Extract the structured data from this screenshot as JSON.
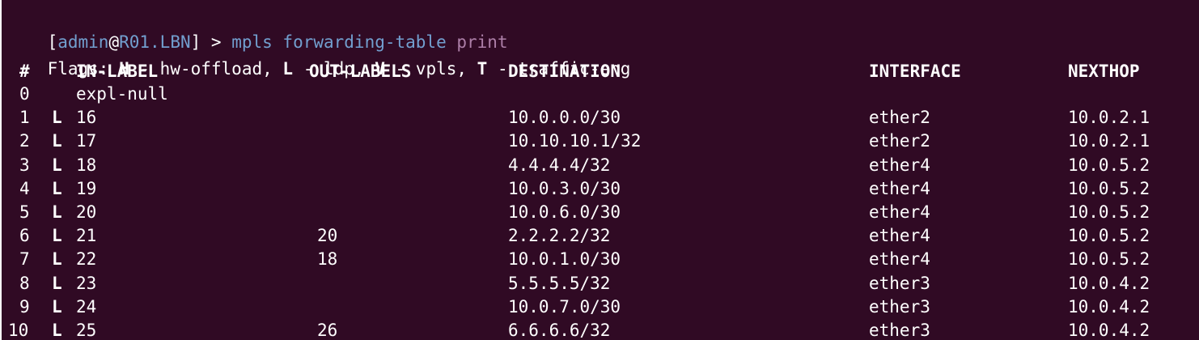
{
  "colors": {
    "background": "#300a24",
    "text": "#ffffff",
    "prompt_blue": "#729fcf",
    "print_purple": "#ad7fa8"
  },
  "prompt": {
    "open_bracket": "[",
    "user": "admin",
    "at": "@",
    "host": "R01.LBN",
    "close": "]",
    "symbol": " > ",
    "command": "mpls forwarding-table ",
    "print": "print"
  },
  "flags": {
    "prefix": "Flags: ",
    "h_key": "H",
    "h_desc": " - hw-offload, ",
    "l_key": "L",
    "l_desc": " - ldp, ",
    "v_key": "V",
    "v_desc": " - vpls, ",
    "t_key": "T",
    "t_desc": " - traffic-eng"
  },
  "headers": {
    "num": "#",
    "in_label": "IN-LABEL",
    "out_labels": "OUT-LABELS",
    "destination": "DESTINATION",
    "interface": "INTERFACE",
    "nexthop": "NEXTHOP"
  },
  "rows": [
    {
      "num": "0",
      "flag": "",
      "in": "expl-null",
      "out": "",
      "dest": "",
      "iface": "",
      "nh": ""
    },
    {
      "num": "1",
      "flag": "L",
      "in": "16",
      "out": "",
      "dest": "10.0.0.0/30",
      "iface": "ether2",
      "nh": "10.0.2.1"
    },
    {
      "num": "2",
      "flag": "L",
      "in": "17",
      "out": "",
      "dest": "10.10.10.1/32",
      "iface": "ether2",
      "nh": "10.0.2.1"
    },
    {
      "num": "3",
      "flag": "L",
      "in": "18",
      "out": "",
      "dest": "4.4.4.4/32",
      "iface": "ether4",
      "nh": "10.0.5.2"
    },
    {
      "num": "4",
      "flag": "L",
      "in": "19",
      "out": "",
      "dest": "10.0.3.0/30",
      "iface": "ether4",
      "nh": "10.0.5.2"
    },
    {
      "num": "5",
      "flag": "L",
      "in": "20",
      "out": "",
      "dest": "10.0.6.0/30",
      "iface": "ether4",
      "nh": "10.0.5.2"
    },
    {
      "num": "6",
      "flag": "L",
      "in": "21",
      "out": "20",
      "dest": "2.2.2.2/32",
      "iface": "ether4",
      "nh": "10.0.5.2"
    },
    {
      "num": "7",
      "flag": "L",
      "in": "22",
      "out": "18",
      "dest": "10.0.1.0/30",
      "iface": "ether4",
      "nh": "10.0.5.2"
    },
    {
      "num": "8",
      "flag": "L",
      "in": "23",
      "out": "",
      "dest": "5.5.5.5/32",
      "iface": "ether3",
      "nh": "10.0.4.2"
    },
    {
      "num": "9",
      "flag": "L",
      "in": "24",
      "out": "",
      "dest": "10.0.7.0/30",
      "iface": "ether3",
      "nh": "10.0.4.2"
    },
    {
      "num": "10",
      "flag": "L",
      "in": "25",
      "out": "26",
      "dest": "6.6.6.6/32",
      "iface": "ether3",
      "nh": "10.0.4.2"
    }
  ]
}
